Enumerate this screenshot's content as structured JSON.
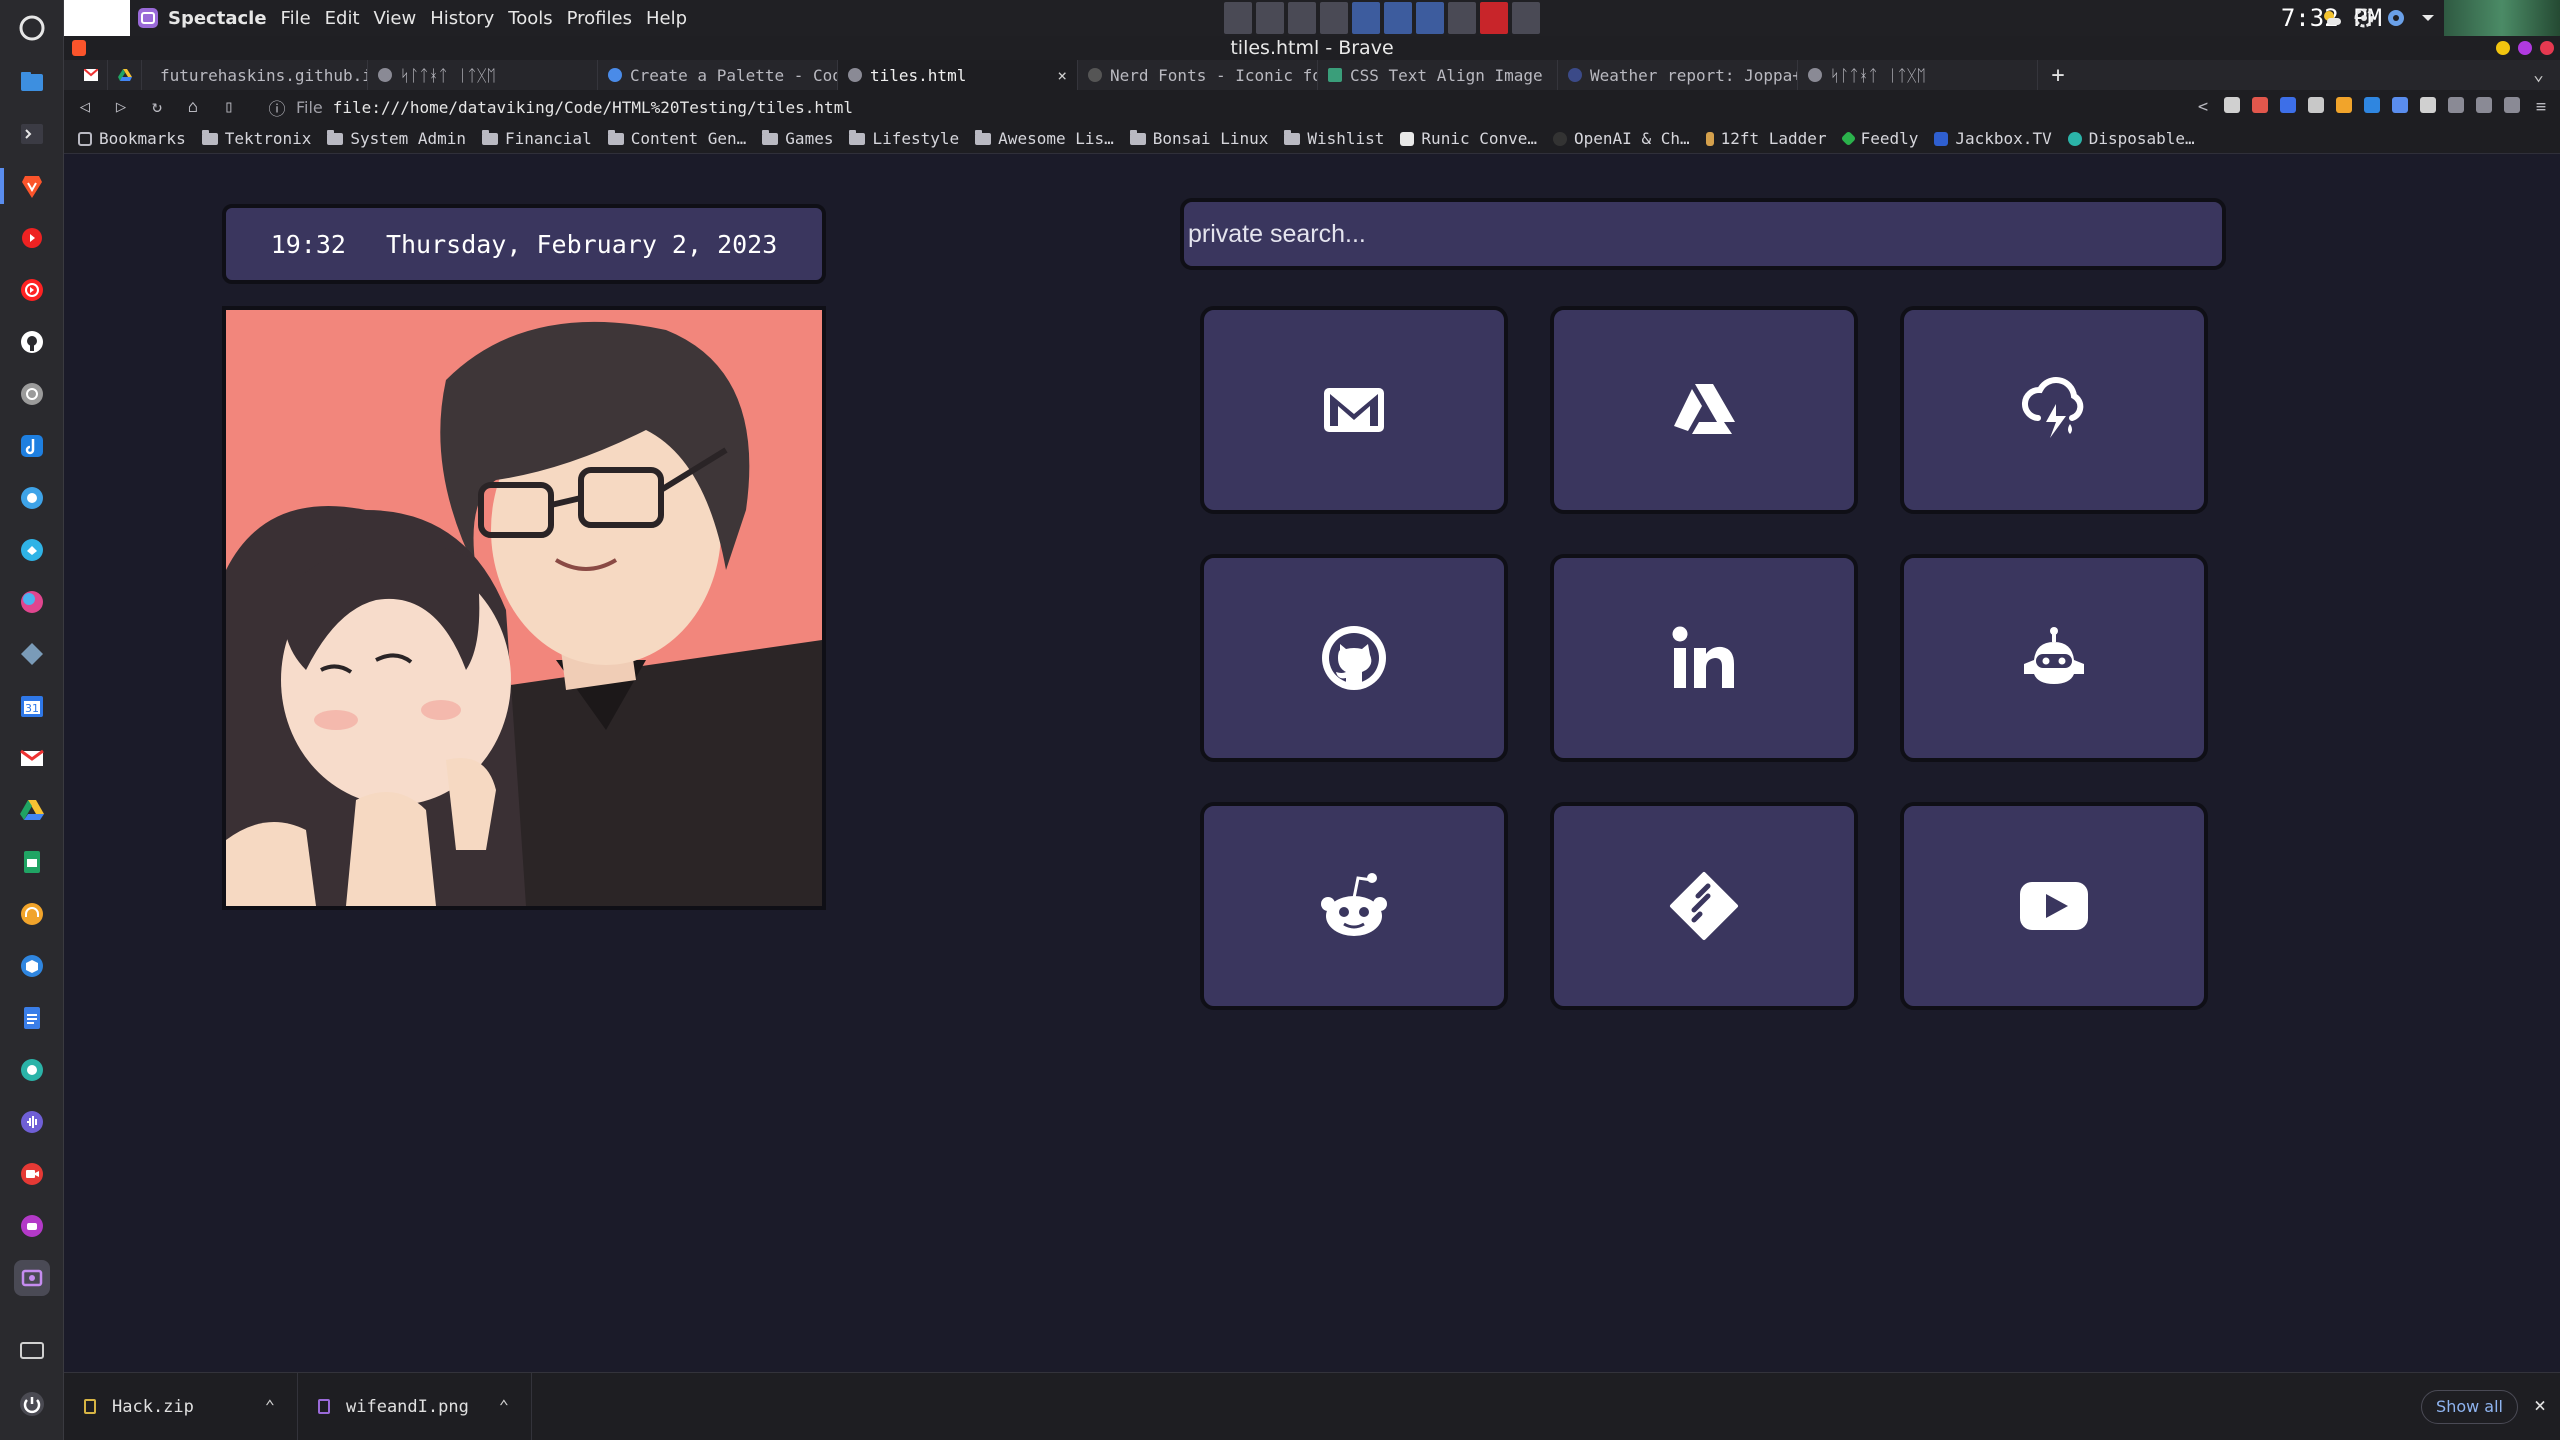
{
  "topbar": {
    "app_name": "Spectacle",
    "menu": [
      "File",
      "Edit",
      "View",
      "History",
      "Tools",
      "Profiles",
      "Help"
    ],
    "clock": "7:32 PM",
    "tray_icons": [
      "weather-icon",
      "settings-icon",
      "gear-icon",
      "chevron-down-icon"
    ]
  },
  "window": {
    "title": "tiles.html - Brave",
    "tabs": [
      {
        "label": "futurehaskins.github.i",
        "icon": "github-icon"
      },
      {
        "label": "ᛋᛚᛏᚼᛏ ᛁᛏᚷᛖ",
        "icon": "globe-icon"
      },
      {
        "label": "Create a Palette - Coo",
        "icon": "palette-icon"
      },
      {
        "label": "tiles.html",
        "icon": "globe-icon",
        "active": true,
        "close": "×"
      },
      {
        "label": "Nerd Fonts - Iconic fo",
        "icon": "nerd-fonts-icon"
      },
      {
        "label": "CSS Text Align Image",
        "icon": "css-icon"
      },
      {
        "label": "Weather report: Joppa+",
        "icon": "weather-icon"
      },
      {
        "label": "ᛋᛚᛏᚼᛏ ᛁᛏᚷᛖ",
        "icon": "globe-icon"
      }
    ],
    "new_tab": "+",
    "url_prefix": "File",
    "url": "file:///home/dataviking/Code/HTML%20Testing/tiles.html",
    "bookmarks": [
      {
        "label": "Bookmarks",
        "type": "bookmark"
      },
      {
        "label": "Tektronix",
        "type": "folder"
      },
      {
        "label": "System Admin",
        "type": "folder"
      },
      {
        "label": "Financial",
        "type": "folder"
      },
      {
        "label": "Content Gen…",
        "type": "folder"
      },
      {
        "label": "Games",
        "type": "folder"
      },
      {
        "label": "Lifestyle",
        "type": "folder"
      },
      {
        "label": "Awesome Lis…",
        "type": "folder"
      },
      {
        "label": "Bonsai Linux",
        "type": "folder"
      },
      {
        "label": "Wishlist",
        "type": "folder"
      },
      {
        "label": "Runic Conve…",
        "type": "site"
      },
      {
        "label": "OpenAI & Ch…",
        "type": "site"
      },
      {
        "label": "12ft Ladder",
        "type": "site"
      },
      {
        "label": "Feedly",
        "type": "site"
      },
      {
        "label": "Jackbox.TV",
        "type": "site"
      },
      {
        "label": "Disposable…",
        "type": "site"
      }
    ]
  },
  "page": {
    "time": "19:32",
    "date": "Thursday, February 2, 2023",
    "search_placeholder": "private search...",
    "tiles": [
      {
        "name": "gmail",
        "icon": "gmail-icon"
      },
      {
        "name": "google-drive",
        "icon": "google-drive-icon"
      },
      {
        "name": "weather",
        "icon": "cloud-lightning-icon"
      },
      {
        "name": "github",
        "icon": "github-icon"
      },
      {
        "name": "linkedin",
        "icon": "linkedin-icon"
      },
      {
        "name": "openai",
        "icon": "robot-icon"
      },
      {
        "name": "reddit",
        "icon": "reddit-icon"
      },
      {
        "name": "feedly",
        "icon": "feedly-icon"
      },
      {
        "name": "youtube",
        "icon": "youtube-icon"
      }
    ]
  },
  "downloads": {
    "items": [
      {
        "filename": "Hack.zip"
      },
      {
        "filename": "wifeandI.png"
      }
    ],
    "show_all": "Show all",
    "close": "×"
  }
}
